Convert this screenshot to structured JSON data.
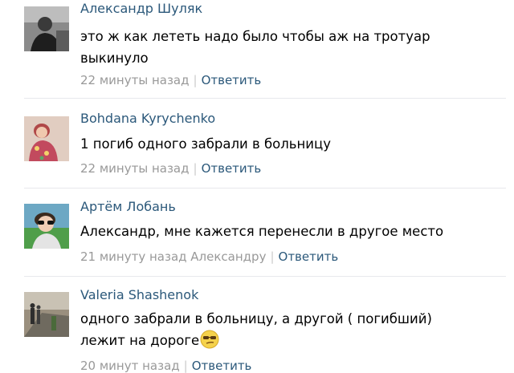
{
  "comments": [
    {
      "author": "Александр Шуляк",
      "text": "это ж как лететь надо было чтобы аж на тротуар выкинуло",
      "time": "22 минуты назад",
      "reply_label": "Ответить"
    },
    {
      "author": "Bohdana Kyrychenko",
      "text": "1 погиб одного забрали в больницу",
      "time": "22 минуты назад",
      "reply_label": "Ответить"
    },
    {
      "author": "Артём Лобань",
      "text": "Александр, мне кажется перенесли в другое место",
      "time": "21 минуту назад Александру",
      "reply_label": "Ответить"
    },
    {
      "author": "Valeria Shashenok",
      "text": "одного забрали в больницу, а другой ( погибший) лежит на дороге",
      "emoji": "smirk-glasses-emoji",
      "time": "20 минут назад",
      "reply_label": "Ответить"
    }
  ],
  "colors": {
    "link": "#2b587a",
    "meta": "#999999",
    "divider": "#e7e8ec"
  }
}
